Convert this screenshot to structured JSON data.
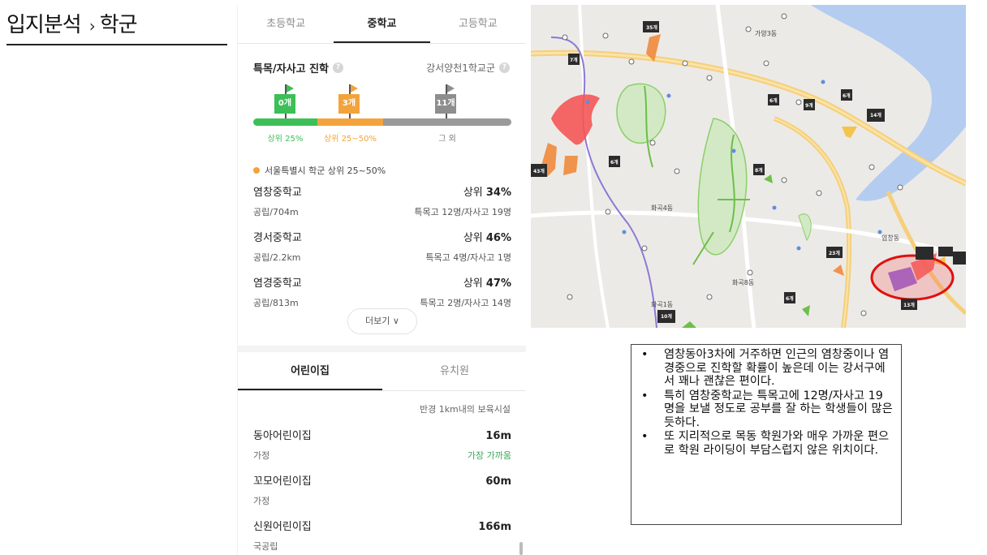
{
  "title": {
    "main": "입지분석",
    "arrow": "›",
    "sub": "학군"
  },
  "school_tabs": [
    "초등학교",
    "중학교",
    "고등학교"
  ],
  "special": {
    "heading": "특목/자사고 진학",
    "district": "강서양천1학교군",
    "flags": [
      {
        "count": "0개",
        "color": "#3dbf57"
      },
      {
        "count": "3개",
        "color": "#f3a33b"
      },
      {
        "count": "11개",
        "color": "#8e8e8e"
      }
    ],
    "bar_labels": [
      {
        "text": "상위 25%",
        "color": "#3dbf57"
      },
      {
        "text": "상위 25~50%",
        "color": "#f3a33b"
      },
      {
        "text": "그 외",
        "color": "#777777"
      }
    ],
    "region_note": "서울특별시 학군 상위 25~50%"
  },
  "schools": [
    {
      "name": "염창중학교",
      "rank_prefix": "상위 ",
      "rank": "34%",
      "sub": "공립/704m",
      "result": "특목고 12명/자사고 19명"
    },
    {
      "name": "경서중학교",
      "rank_prefix": "상위 ",
      "rank": "46%",
      "sub": "공립/2.2km",
      "result": "특목고 4명/자사고 1명"
    },
    {
      "name": "염경중학교",
      "rank_prefix": "상위 ",
      "rank": "47%",
      "sub": "공립/813m",
      "result": "특목고 2명/자사고 14명"
    }
  ],
  "more_label": "더보기 ∨",
  "care_tabs": [
    "어린이집",
    "유치원"
  ],
  "radius_label": "반경 1km내의 보육시설",
  "daycares": [
    {
      "name": "동아어린이집",
      "dist": "16m",
      "type": "가정",
      "note": "가장 가까움"
    },
    {
      "name": "꼬모어린이집",
      "dist": "60m",
      "type": "가정",
      "note": ""
    },
    {
      "name": "신원어린이집",
      "dist": "166m",
      "type": "국공립",
      "note": ""
    }
  ],
  "map_labels": {
    "area_top": "가양3동",
    "area_mid": "화곡8동",
    "area_low": "화곡1동",
    "area_right": "염창동",
    "area_bottom": "화곡4동",
    "badges": [
      "35개",
      "7개",
      "6개",
      "6개",
      "9개",
      "14개",
      "8개",
      "43개",
      "6개",
      "23개",
      "13개",
      "10개",
      "6개"
    ]
  },
  "notes": [
    "염창동아3차에 거주하면 인근의 염창중이나 염경중으로 진학할 확률이 높은데 이는 강서구에서 꽤나 괜찮은 편이다.",
    "특히 염창중학교는 특목고에 12명/자사고 19명을 보낼 정도로 공부를 잘 하는 학생들이 많은 듯하다.",
    "또 지리적으로 목동 학원가와 매우 가까운 편으로 학원 라이딩이 부담스럽지 않은 위치이다."
  ]
}
